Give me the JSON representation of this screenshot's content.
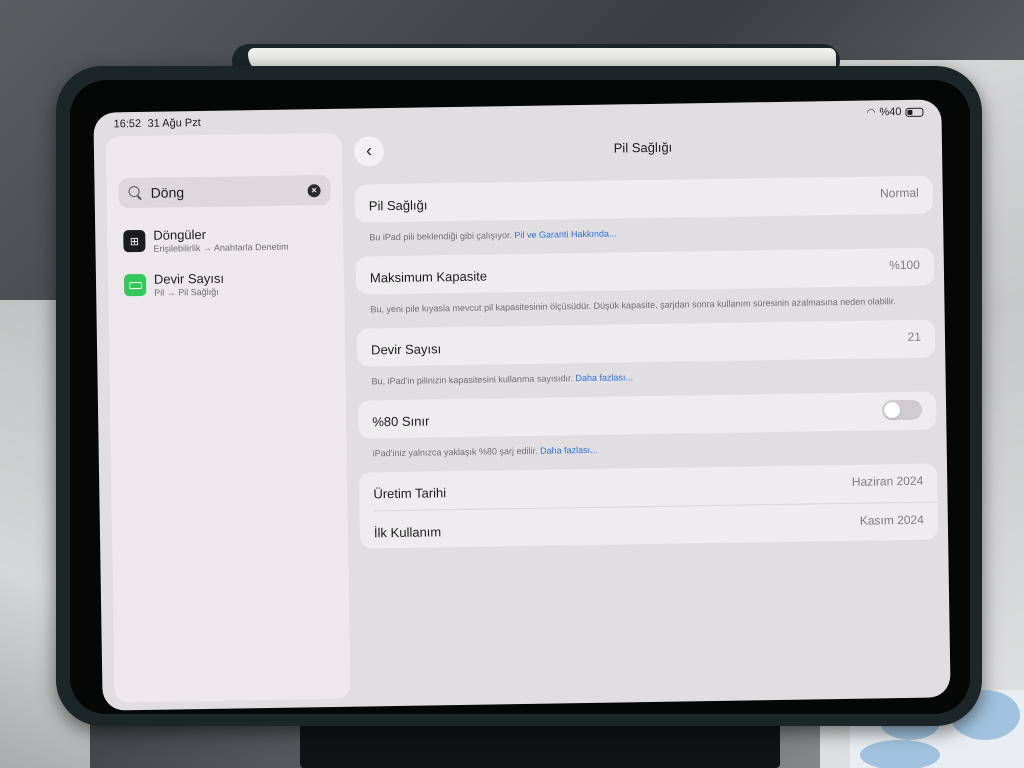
{
  "status_bar": {
    "time": "16:52",
    "date": "31 Ağu Pzt",
    "battery_percent": "%40"
  },
  "sidebar": {
    "search": {
      "value": "Döng"
    },
    "results": [
      {
        "title": "Döngüler",
        "subtitle": "Erişilebilirlik → Anahtarla Denetim",
        "icon": "accessibility-icon"
      },
      {
        "title": "Devir Sayısı",
        "subtitle": "Pil → Pil Sağlığı",
        "icon": "battery-icon"
      }
    ]
  },
  "page": {
    "title": "Pil Sağlığı",
    "battery_health": {
      "label": "Pil Sağlığı",
      "value": "Normal",
      "footnote": "Bu iPad pili beklendiği gibi çalışıyor.",
      "link": "Pil ve Garanti Hakkında..."
    },
    "max_capacity": {
      "label": "Maksimum Kapasite",
      "value": "%100",
      "footnote": "Bu, yeni pile kıyasla mevcut pil kapasitesinin ölçüsüdür. Düşük kapasite, şarjdan sonra kullanım süresinin azalmasına neden olabilir."
    },
    "cycle_count": {
      "label": "Devir Sayısı",
      "value": "21",
      "footnote": "Bu, iPad'in pilinizin kapasitesini kullanma sayısıdır.",
      "link": "Daha fazlası..."
    },
    "limit_80": {
      "label": "%80 Sınır",
      "enabled": false,
      "footnote": "iPad'iniz yalnızca yaklaşık %80 şarj edilir.",
      "link": "Daha fazlası..."
    },
    "dates": {
      "manufacture_label": "Üretim Tarihi",
      "manufacture_value": "Haziran 2024",
      "first_use_label": "İlk Kullanım",
      "first_use_value": "Kasım 2024"
    }
  }
}
